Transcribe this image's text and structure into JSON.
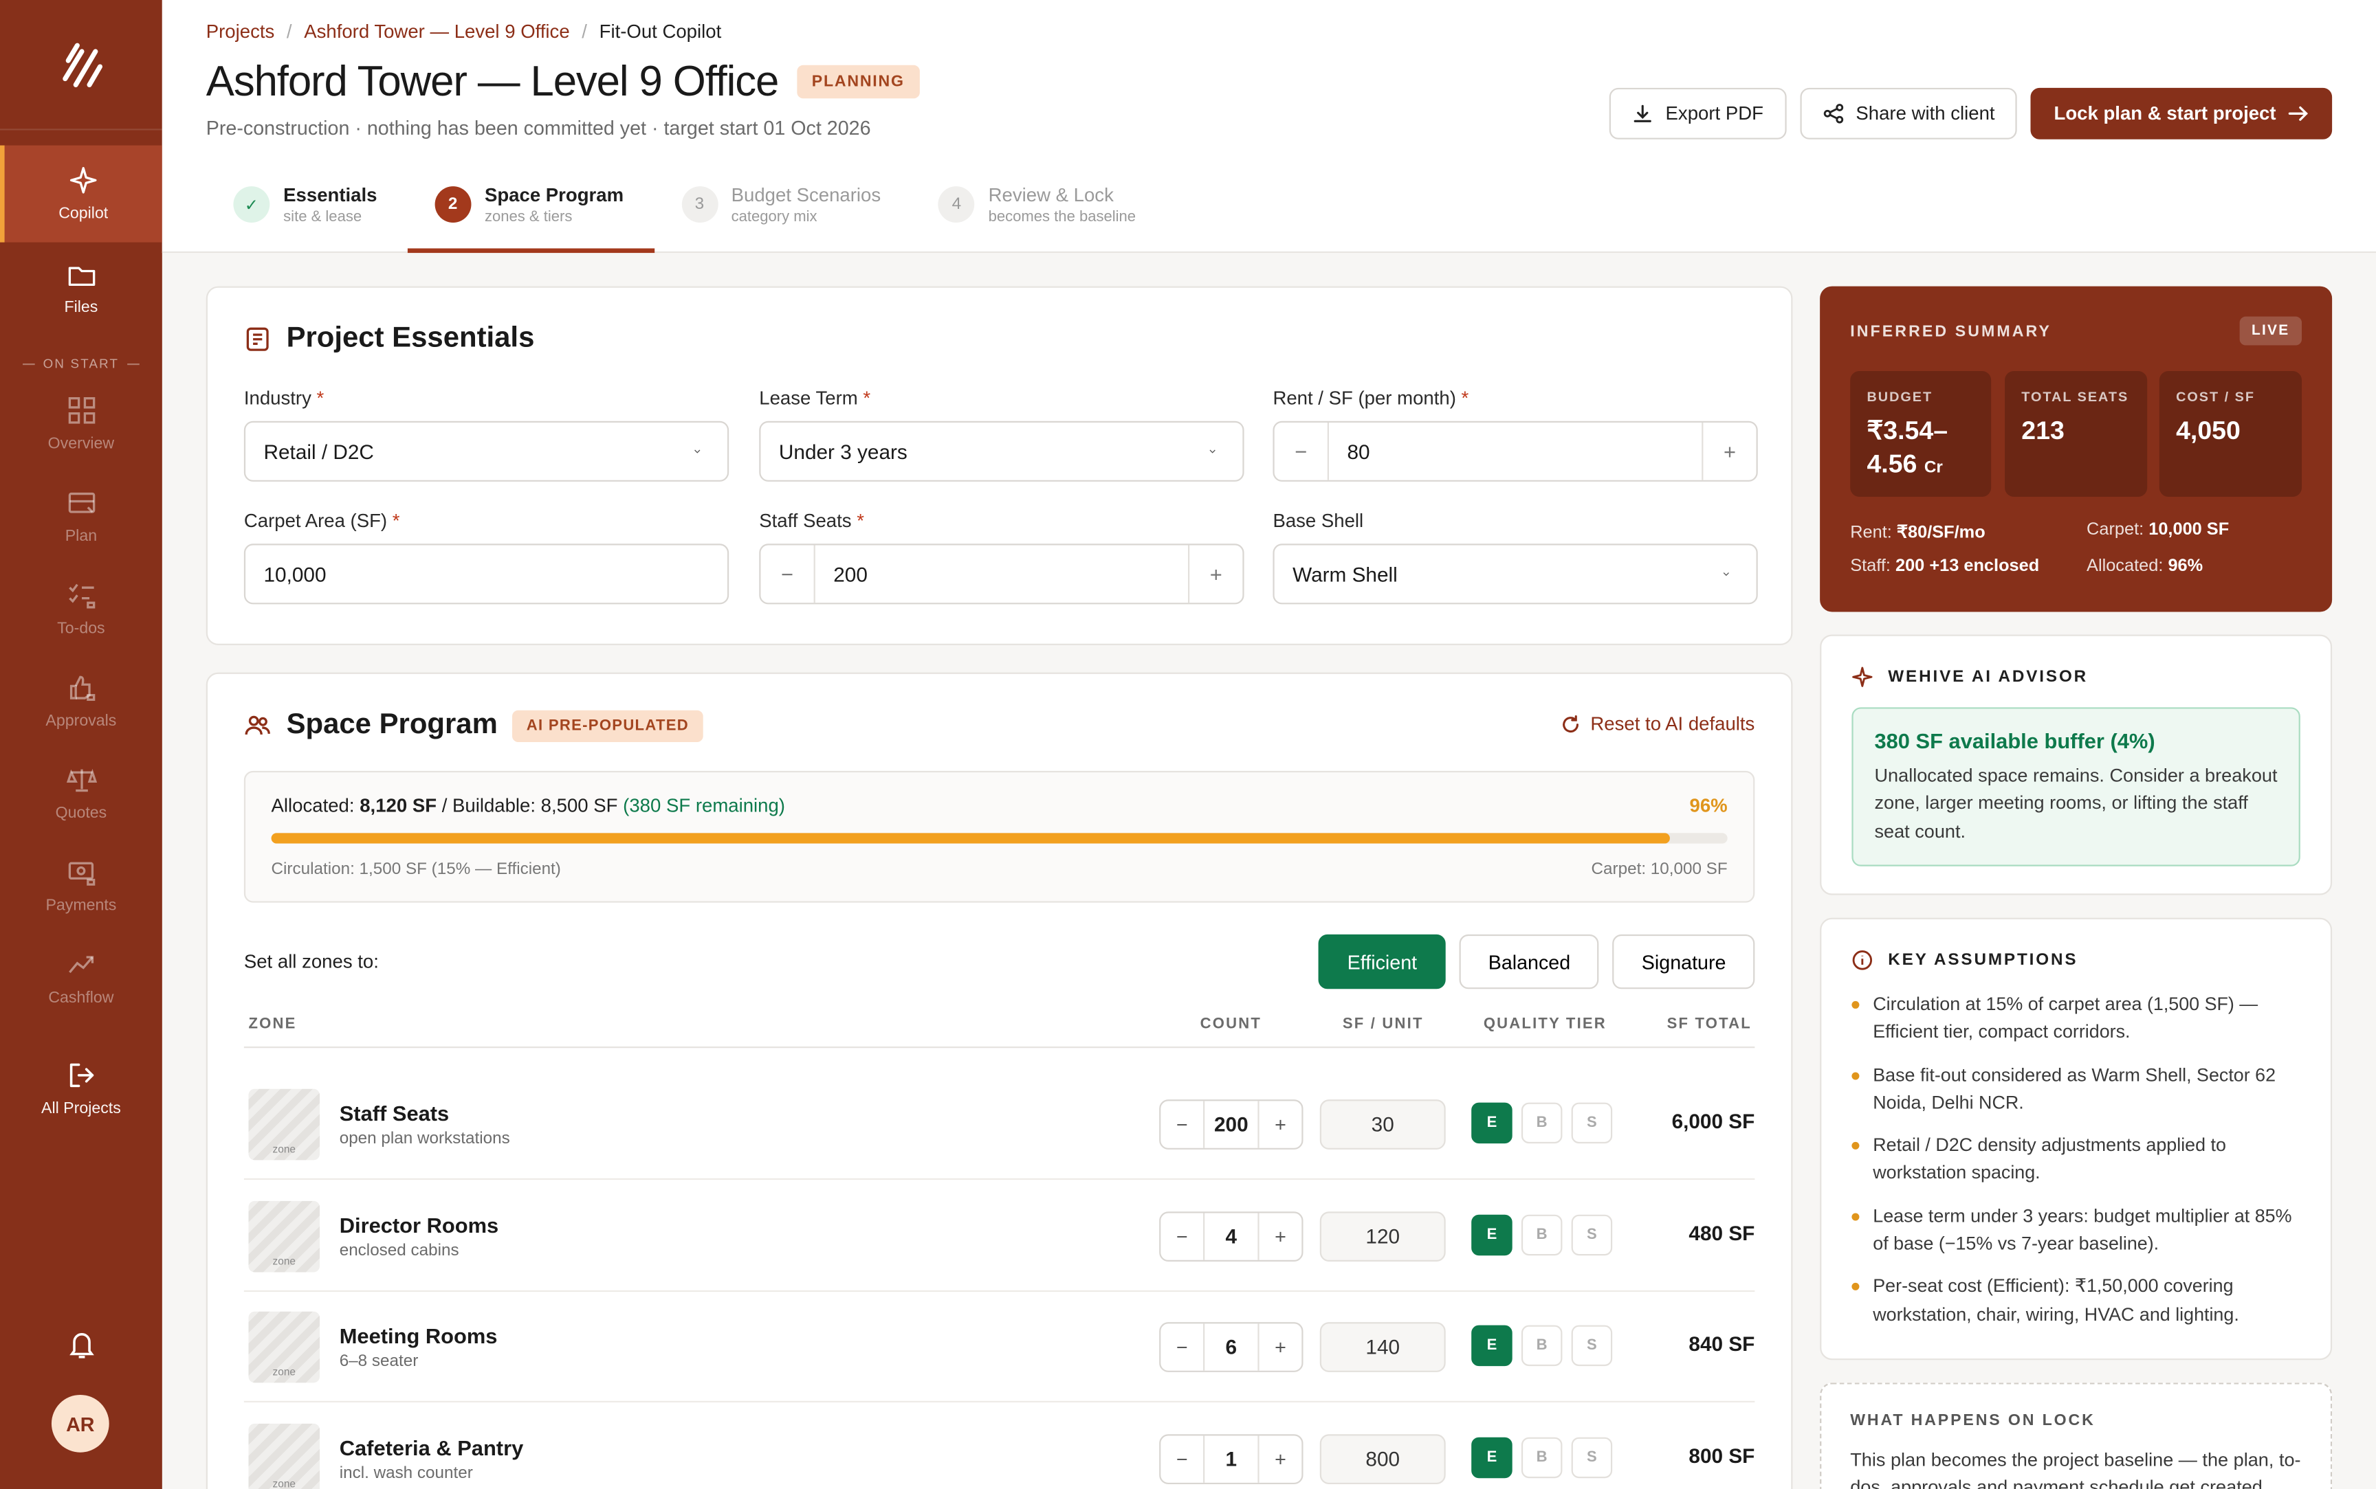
{
  "sidebar": {
    "items": [
      {
        "label": "Copilot"
      },
      {
        "label": "Files"
      },
      {
        "label": "Overview"
      },
      {
        "label": "Plan"
      },
      {
        "label": "To-dos"
      },
      {
        "label": "Approvals"
      },
      {
        "label": "Quotes"
      },
      {
        "label": "Payments"
      },
      {
        "label": "Cashflow"
      },
      {
        "label": "All Projects"
      }
    ],
    "section_label": "ON START",
    "avatar": "AR"
  },
  "breadcrumb": [
    "Projects",
    "Ashford Tower — Level 9 Office",
    "Fit-Out Copilot"
  ],
  "header": {
    "title": "Ashford Tower — Level 9 Office",
    "status": "PLANNING",
    "subtitle": "Pre-construction · nothing has been committed yet · target start 01 Oct 2026",
    "export_label": "Export PDF",
    "share_label": "Share with client",
    "lock_label": "Lock plan & start project"
  },
  "steps": [
    {
      "num": "✓",
      "label": "Essentials",
      "sub": "site & lease"
    },
    {
      "num": "2",
      "label": "Space Program",
      "sub": "zones & tiers"
    },
    {
      "num": "3",
      "label": "Budget Scenarios",
      "sub": "category mix"
    },
    {
      "num": "4",
      "label": "Review & Lock",
      "sub": "becomes the baseline"
    }
  ],
  "essentials": {
    "title": "Project Essentials",
    "industry": {
      "label": "Industry",
      "value": "Retail / D2C"
    },
    "lease": {
      "label": "Lease Term",
      "value": "Under 3 years"
    },
    "rent": {
      "label": "Rent / SF (per month)",
      "value": "80"
    },
    "carpet": {
      "label": "Carpet Area (SF)",
      "value": "10,000"
    },
    "seats": {
      "label": "Staff Seats",
      "value": "200"
    },
    "shell": {
      "label": "Base Shell",
      "value": "Warm Shell"
    },
    "required_mark": "*"
  },
  "program": {
    "title": "Space Program",
    "badge": "AI PRE-POPULATED",
    "reset_label": "Reset to AI defaults",
    "alloc_label": "Allocated:",
    "alloc_value": "8,120 SF",
    "buildable_label": " / Buildable: 8,500 SF ",
    "remaining": "(380 SF remaining)",
    "pct": "96%",
    "pct_value": 0.96,
    "circulation": "Circulation: 1,500 SF (15% — Efficient)",
    "carpet": "Carpet: 10,000 SF",
    "set_all_label": "Set all zones to:",
    "tiers": [
      "Efficient",
      "Balanced",
      "Signature"
    ],
    "columns": [
      "ZONE",
      "COUNT",
      "SF / UNIT",
      "QUALITY TIER",
      "SF TOTAL"
    ],
    "thumb_label": "zone",
    "tier_letters": [
      "E",
      "B",
      "S"
    ],
    "stepper_minus": "−",
    "stepper_plus": "+",
    "zones": [
      {
        "name": "Staff Seats",
        "sub": "open plan workstations",
        "count": "200",
        "sf_unit": "30",
        "total": "6,000 SF"
      },
      {
        "name": "Director Rooms",
        "sub": "enclosed cabins",
        "count": "4",
        "sf_unit": "120",
        "total": "480 SF"
      },
      {
        "name": "Meeting Rooms",
        "sub": "6–8 seater",
        "count": "6",
        "sf_unit": "140",
        "total": "840 SF"
      },
      {
        "name": "Cafeteria & Pantry",
        "sub": "incl. wash counter",
        "count": "1",
        "sf_unit": "800",
        "total": "800 SF"
      }
    ]
  },
  "summary": {
    "title": "INFERRED SUMMARY",
    "live": "LIVE",
    "budget_label": "BUDGET",
    "budget_value": "₹3.54–4.56",
    "budget_unit": "Cr",
    "seats_label": "TOTAL SEATS",
    "seats_value": "213",
    "cost_label": "COST / SF",
    "cost_value": "4,050",
    "rent_label": "Rent:",
    "rent_value": "₹80/SF/mo",
    "carpet_label": "Carpet:",
    "carpet_value": "10,000 SF",
    "staff_label": "Staff:",
    "staff_value": "200 +13 enclosed",
    "alloc_label": "Allocated:",
    "alloc_value": "96%"
  },
  "advisor": {
    "title": "WEHIVE AI ADVISOR",
    "headline": "380 SF available buffer (4%)",
    "body": "Unallocated space remains. Consider a breakout zone, larger meeting rooms, or lifting the staff seat count."
  },
  "assumptions": {
    "title": "KEY ASSUMPTIONS",
    "items": [
      "Circulation at 15% of carpet area (1,500 SF) — Efficient tier, compact corridors.",
      "Base fit-out considered as Warm Shell, Sector 62 Noida, Delhi NCR.",
      "Retail / D2C density adjustments applied to workstation spacing.",
      "Lease term under 3 years: budget multiplier at 85% of base (−15% vs 7-year baseline).",
      "Per-seat cost (Efficient): ₹1,50,000 covering workstation, chair, wiring, HVAC and lighting."
    ]
  },
  "lock": {
    "title": "WHAT HAPPENS ON LOCK",
    "body": "This plan becomes the project baseline — the plan, to-dos, approvals and payment schedule get created"
  },
  "colors": {
    "brand": "#86301a",
    "accent": "#f2a01f",
    "success": "#0e7a4c"
  }
}
